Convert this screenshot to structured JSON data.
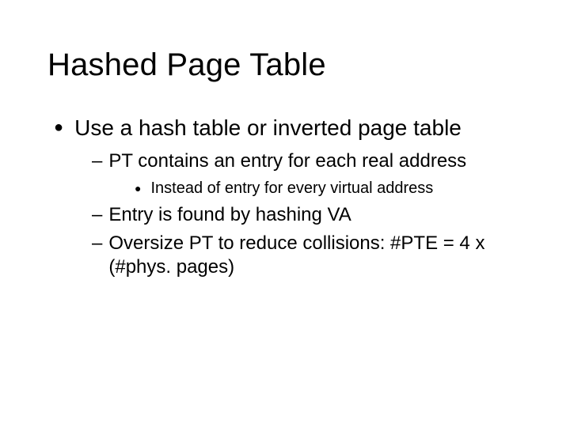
{
  "title": "Hashed Page Table",
  "bullets": {
    "l1": "Use a hash table or inverted page table",
    "l2a": "PT contains an entry for each real address",
    "l3a": "Instead of entry for every virtual address",
    "l2b": "Entry is found by hashing VA",
    "l2c": "Oversize PT to reduce collisions: #PTE = 4 x (#phys. pages)"
  }
}
